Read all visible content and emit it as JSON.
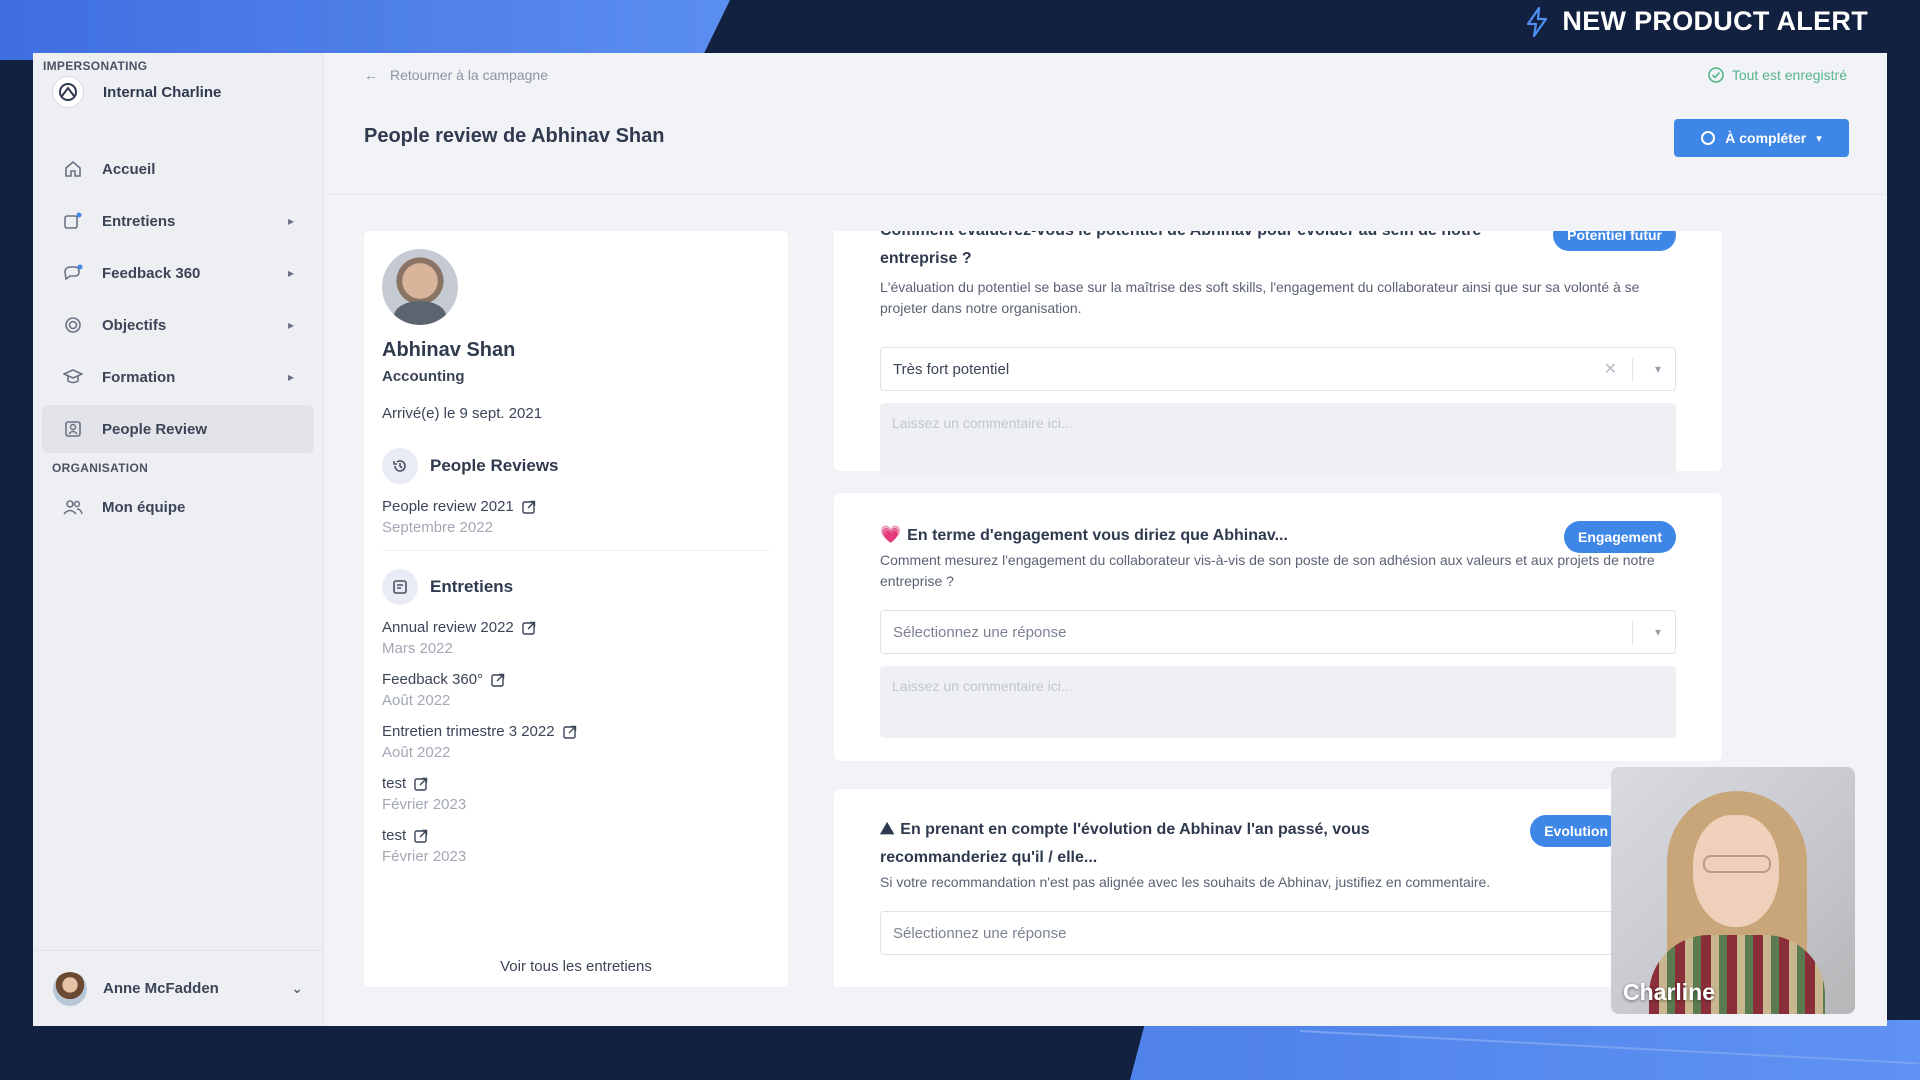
{
  "banner": {
    "alert_text": "NEW PRODUCT ALERT"
  },
  "sidebar": {
    "impersonating_label": "IMPERSONATING",
    "impersonated_user": "Internal Charline",
    "items": [
      {
        "label": "Accueil",
        "icon": "home-icon",
        "has_submenu": false,
        "active": false
      },
      {
        "label": "Entretiens",
        "icon": "interview-icon",
        "has_submenu": true,
        "active": false
      },
      {
        "label": "Feedback 360",
        "icon": "feedback-icon",
        "has_submenu": true,
        "active": false
      },
      {
        "label": "Objectifs",
        "icon": "target-icon",
        "has_submenu": true,
        "active": false
      },
      {
        "label": "Formation",
        "icon": "graduation-cap-icon",
        "has_submenu": true,
        "active": false
      },
      {
        "label": "People Review",
        "icon": "people-review-icon",
        "has_submenu": false,
        "active": true
      }
    ],
    "organisation_label": "ORGANISATION",
    "org_items": [
      {
        "label": "Mon équipe",
        "icon": "team-icon"
      }
    ],
    "current_user": "Anne McFadden"
  },
  "header": {
    "back_label": "Retourner à la campagne",
    "saved_status": "Tout est enregistré",
    "title": "People review de Abhinav Shan",
    "status_button": "À compléter"
  },
  "profile": {
    "name": "Abhinav Shan",
    "department": "Accounting",
    "arrival": "Arrivé(e) le 9 sept. 2021",
    "people_reviews_title": "People Reviews",
    "people_reviews": [
      {
        "label": "People review 2021",
        "date": "Septembre 2022"
      }
    ],
    "entretiens_title": "Entretiens",
    "entretiens": [
      {
        "label": "Annual review 2022",
        "date": "Mars 2022"
      },
      {
        "label": "Feedback 360°",
        "date": "Août 2022"
      },
      {
        "label": "Entretien trimestre 3 2022",
        "date": "Août 2022"
      },
      {
        "label": "test",
        "date": "Février 2023"
      },
      {
        "label": "test",
        "date": "Février 2023"
      }
    ],
    "see_all": "Voir tous les entretiens"
  },
  "questions": [
    {
      "title": "Comment évaluerez-vous le potentiel de Abhinav pour évoluer au sein de notre entreprise ?",
      "description": "L'évaluation du potentiel se base sur la maîtrise des soft skills, l'engagement du collaborateur ainsi que sur sa volonté à se projeter dans notre organisation.",
      "tag": "Potentiel futur",
      "selected": "Très fort potentiel",
      "comment_placeholder": "Laissez un commentaire ici..."
    },
    {
      "emoji": "💗",
      "title": "En terme d'engagement vous diriez que Abhinav...",
      "description": "Comment mesurez l'engagement du collaborateur vis-à-vis de son poste de son adhésion aux valeurs et aux projets de notre entreprise ?",
      "tag": "Engagement",
      "select_placeholder": "Sélectionnez une réponse",
      "comment_placeholder": "Laissez un commentaire ici..."
    },
    {
      "emoji": "⛰",
      "title": "En prenant en compte l'évolution de Abhinav l'an passé, vous recommanderiez qu'il / elle...",
      "description": "Si votre recommandation n'est pas alignée avec les souhaits de Abhinav, justifiez en commentaire.",
      "tag": "Evolution",
      "select_placeholder": "Sélectionnez une réponse"
    }
  ],
  "video": {
    "name": "Charline"
  },
  "colors": {
    "accent": "#3f87e6",
    "saved": "#58b58a",
    "banner": "#4f82ea"
  }
}
